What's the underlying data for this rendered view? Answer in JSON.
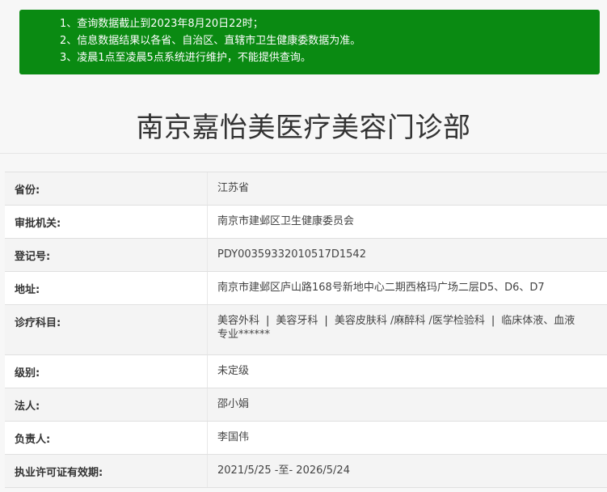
{
  "notice": {
    "lines": [
      "1、查询数据截止到2023年8月20日22时；",
      "2、信息数据结果以各省、自治区、直辖市卫生健康委数据为准。",
      "3、凌晨1点至凌晨5点系统进行维护，不能提供查询。"
    ]
  },
  "title": "南京嘉怡美医疗美容门诊部",
  "info": {
    "province": {
      "label": "省份:",
      "value": "江苏省"
    },
    "authority": {
      "label": "审批机关:",
      "value": "南京市建邺区卫生健康委员会"
    },
    "reg_no": {
      "label": "登记号:",
      "value": "PDY00359332010517D1542"
    },
    "address": {
      "label": "地址:",
      "value": "南京市建邺区庐山路168号新地中心二期西格玛广场二层D5、D6、D7"
    },
    "departments": {
      "label": "诊疗科目:",
      "items": [
        "美容外科",
        "美容牙科",
        "美容皮肤科 /麻醉科 /医学检验科",
        "临床体液、血液"
      ],
      "tail": "专业******"
    },
    "level": {
      "label": "级别:",
      "value": "未定级"
    },
    "legal": {
      "label": "法人:",
      "value": "邵小娟"
    },
    "manager": {
      "label": "负责人:",
      "value": "李国伟"
    },
    "license": {
      "label": "执业许可证有效期:",
      "value": "2021/5/25 -至- 2026/5/24"
    }
  }
}
